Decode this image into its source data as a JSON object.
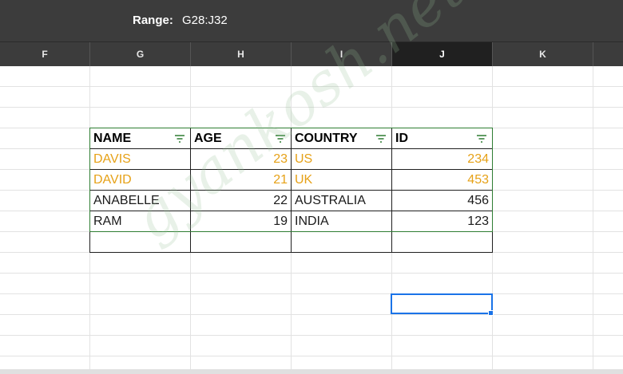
{
  "range_bar": {
    "label": "Range:",
    "value": "G28:J32"
  },
  "columns": [
    {
      "letter": "F",
      "active": false
    },
    {
      "letter": "G",
      "active": false
    },
    {
      "letter": "H",
      "active": false
    },
    {
      "letter": "I",
      "active": false
    },
    {
      "letter": "J",
      "active": true
    },
    {
      "letter": "K",
      "active": false
    }
  ],
  "table": {
    "headers": [
      "NAME",
      "AGE",
      "COUNTRY",
      "ID"
    ],
    "rows": [
      {
        "name": "DAVIS",
        "age": "23",
        "country": "US",
        "id": "234",
        "highlight": true
      },
      {
        "name": "DAVID",
        "age": "21",
        "country": "UK",
        "id": "453",
        "highlight": true
      },
      {
        "name": "ANABELLE",
        "age": "22",
        "country": "AUSTRALIA",
        "id": "456",
        "highlight": false
      },
      {
        "name": "RAM",
        "age": "19",
        "country": "INDIA",
        "id": "123",
        "highlight": false
      }
    ]
  },
  "watermark": "gyankosh.net",
  "colors": {
    "highlight_text": "#e6a117",
    "filter_icon": "#2e7d32",
    "selection": "#1a73e8",
    "toolbar_bg": "#3c3c3c"
  },
  "icons": {
    "column_filter": "filter-icon"
  }
}
